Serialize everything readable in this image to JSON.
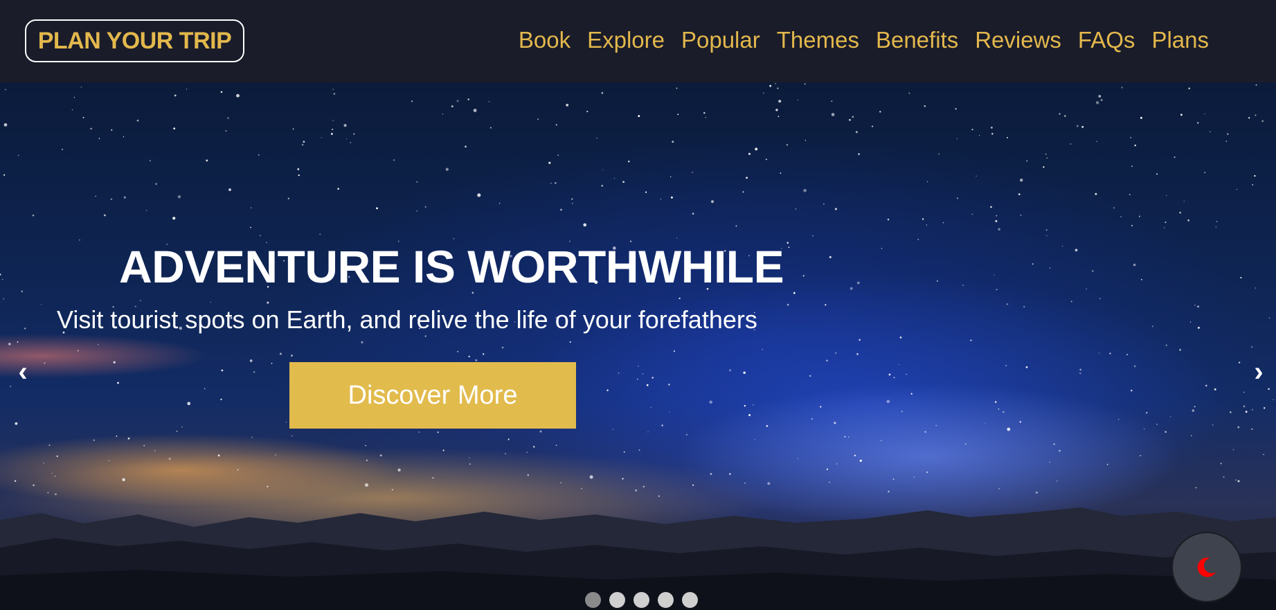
{
  "brand": {
    "logo_text": "PLAN YOUR TRIP"
  },
  "nav": {
    "items": [
      {
        "label": "Book"
      },
      {
        "label": "Explore"
      },
      {
        "label": "Popular"
      },
      {
        "label": "Themes"
      },
      {
        "label": "Benefits"
      },
      {
        "label": "Reviews"
      },
      {
        "label": "FAQs"
      },
      {
        "label": "Plans"
      }
    ]
  },
  "hero": {
    "title": "ADVENTURE IS WORTHWHILE",
    "subtitle": "Visit tourist spots on Earth, and relive the life of your forefathers",
    "cta_label": "Discover More",
    "prev_arrow": "‹",
    "next_arrow": "›",
    "slide_count": 5,
    "active_slide": 1
  },
  "theme_toggle": {
    "icon": "moon-icon",
    "icon_color": "#ff0000"
  },
  "colors": {
    "accent": "#e3b84c",
    "navbar_bg": "#1a1c2a",
    "button_bg": "#e2bb4d"
  }
}
